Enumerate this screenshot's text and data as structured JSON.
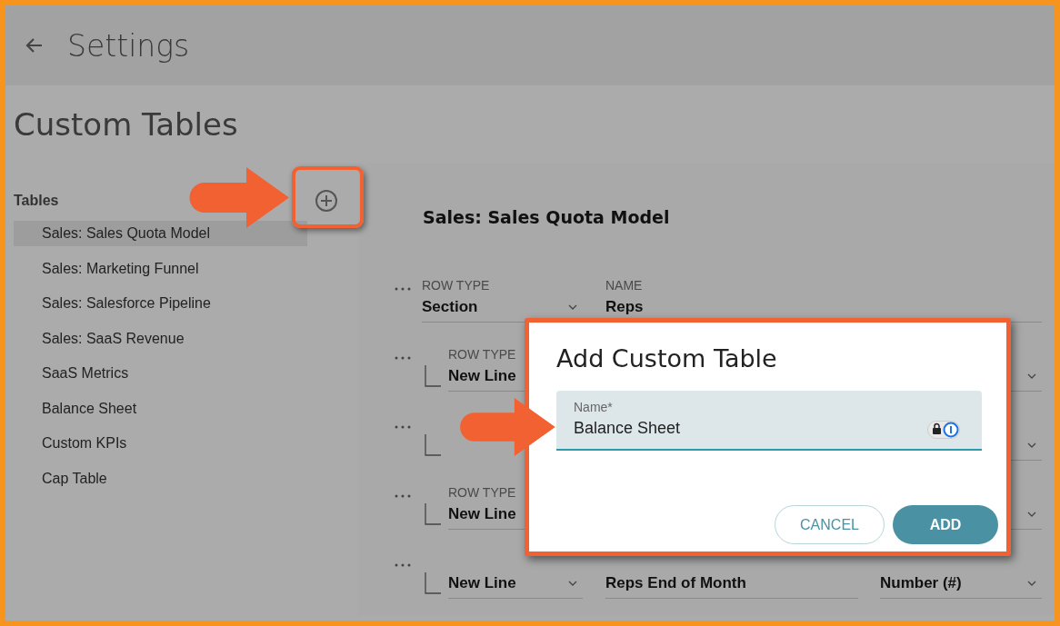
{
  "header": {
    "title": "Settings"
  },
  "page_title": "Custom Tables",
  "sidebar": {
    "heading": "Tables",
    "items": [
      {
        "label": "Sales: Sales Quota Model",
        "selected": true
      },
      {
        "label": "Sales: Marketing Funnel",
        "selected": false
      },
      {
        "label": "Sales: Salesforce Pipeline",
        "selected": false
      },
      {
        "label": "Sales: SaaS Revenue",
        "selected": false
      },
      {
        "label": "SaaS Metrics",
        "selected": false
      },
      {
        "label": "Balance Sheet",
        "selected": false
      },
      {
        "label": "Custom KPIs",
        "selected": false
      },
      {
        "label": "Cap Table",
        "selected": false
      }
    ]
  },
  "table": {
    "title": "Sales: Sales Quota Model",
    "rows": [
      {
        "kind": "section",
        "row_type": {
          "label": "ROW TYPE",
          "value": "Section",
          "dropdown": true
        },
        "name": {
          "label": "NAME",
          "value": "Reps"
        }
      },
      {
        "kind": "line",
        "row_type": {
          "label": "ROW TYPE",
          "value": "New Line"
        },
        "format": {
          "dropdown": true
        }
      },
      {
        "kind": "line",
        "format": {
          "dropdown": true
        }
      },
      {
        "kind": "line",
        "row_type": {
          "label": "ROW TYPE",
          "value": "New Line"
        },
        "format": {
          "dropdown": true
        }
      },
      {
        "kind": "line",
        "row_type": {
          "value": "New Line",
          "dropdown": true
        },
        "name": {
          "value": "Reps End of Month"
        },
        "format": {
          "value": "Number (#)",
          "dropdown": true
        }
      }
    ]
  },
  "dialog": {
    "title": "Add Custom Table",
    "field": {
      "label": "Name*",
      "value": "Balance Sheet"
    },
    "buttons": [
      {
        "label": "CANCEL",
        "kind": "secondary"
      },
      {
        "label": "ADD",
        "kind": "primary"
      }
    ]
  }
}
